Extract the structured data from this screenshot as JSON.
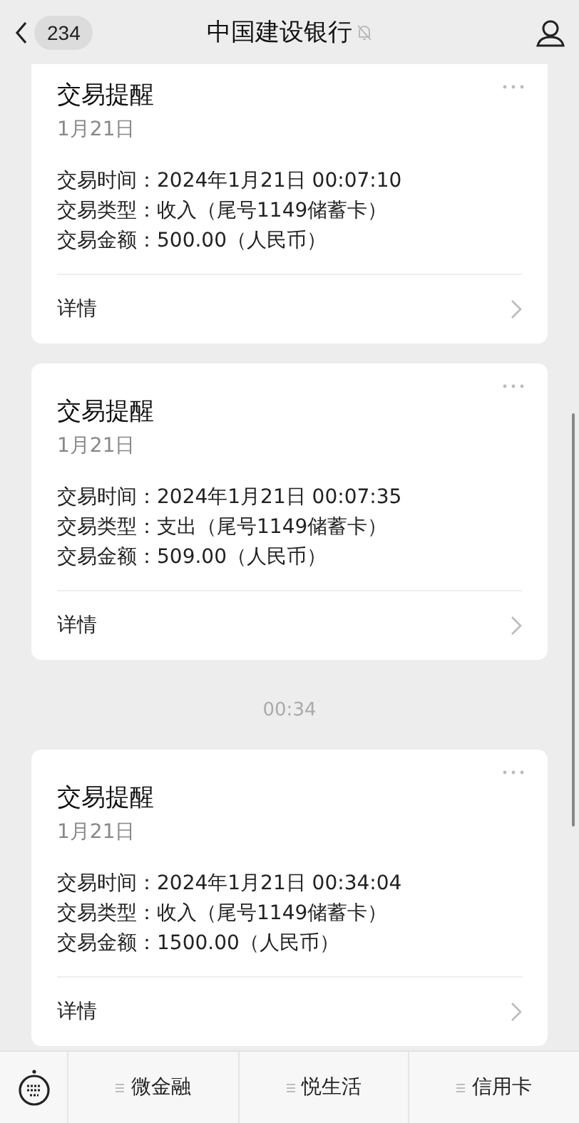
{
  "header": {
    "back_count": "234",
    "title": "中国建设银行",
    "muted": true
  },
  "messages": [
    {
      "title": "交易提醒",
      "date": "1月21日",
      "lines": [
        "交易时间：2024年1月21日 00:07:10",
        "交易类型：收入（尾号1149储蓄卡）",
        "交易金额：500.00（人民币）"
      ],
      "link": "详情"
    },
    {
      "title": "交易提醒",
      "date": "1月21日",
      "lines": [
        "交易时间：2024年1月21日 00:07:35",
        "交易类型：支出（尾号1149储蓄卡）",
        "交易金额：509.00（人民币）"
      ],
      "link": "详情"
    },
    {
      "time": "00:34",
      "title": "交易提醒",
      "date": "1月21日",
      "lines": [
        "交易时间：2024年1月21日 00:34:04",
        "交易类型：收入（尾号1149储蓄卡）",
        "交易金额：1500.00（人民币）"
      ],
      "link": "详情"
    }
  ],
  "menu": [
    "微金融",
    "悦生活",
    "信用卡"
  ]
}
